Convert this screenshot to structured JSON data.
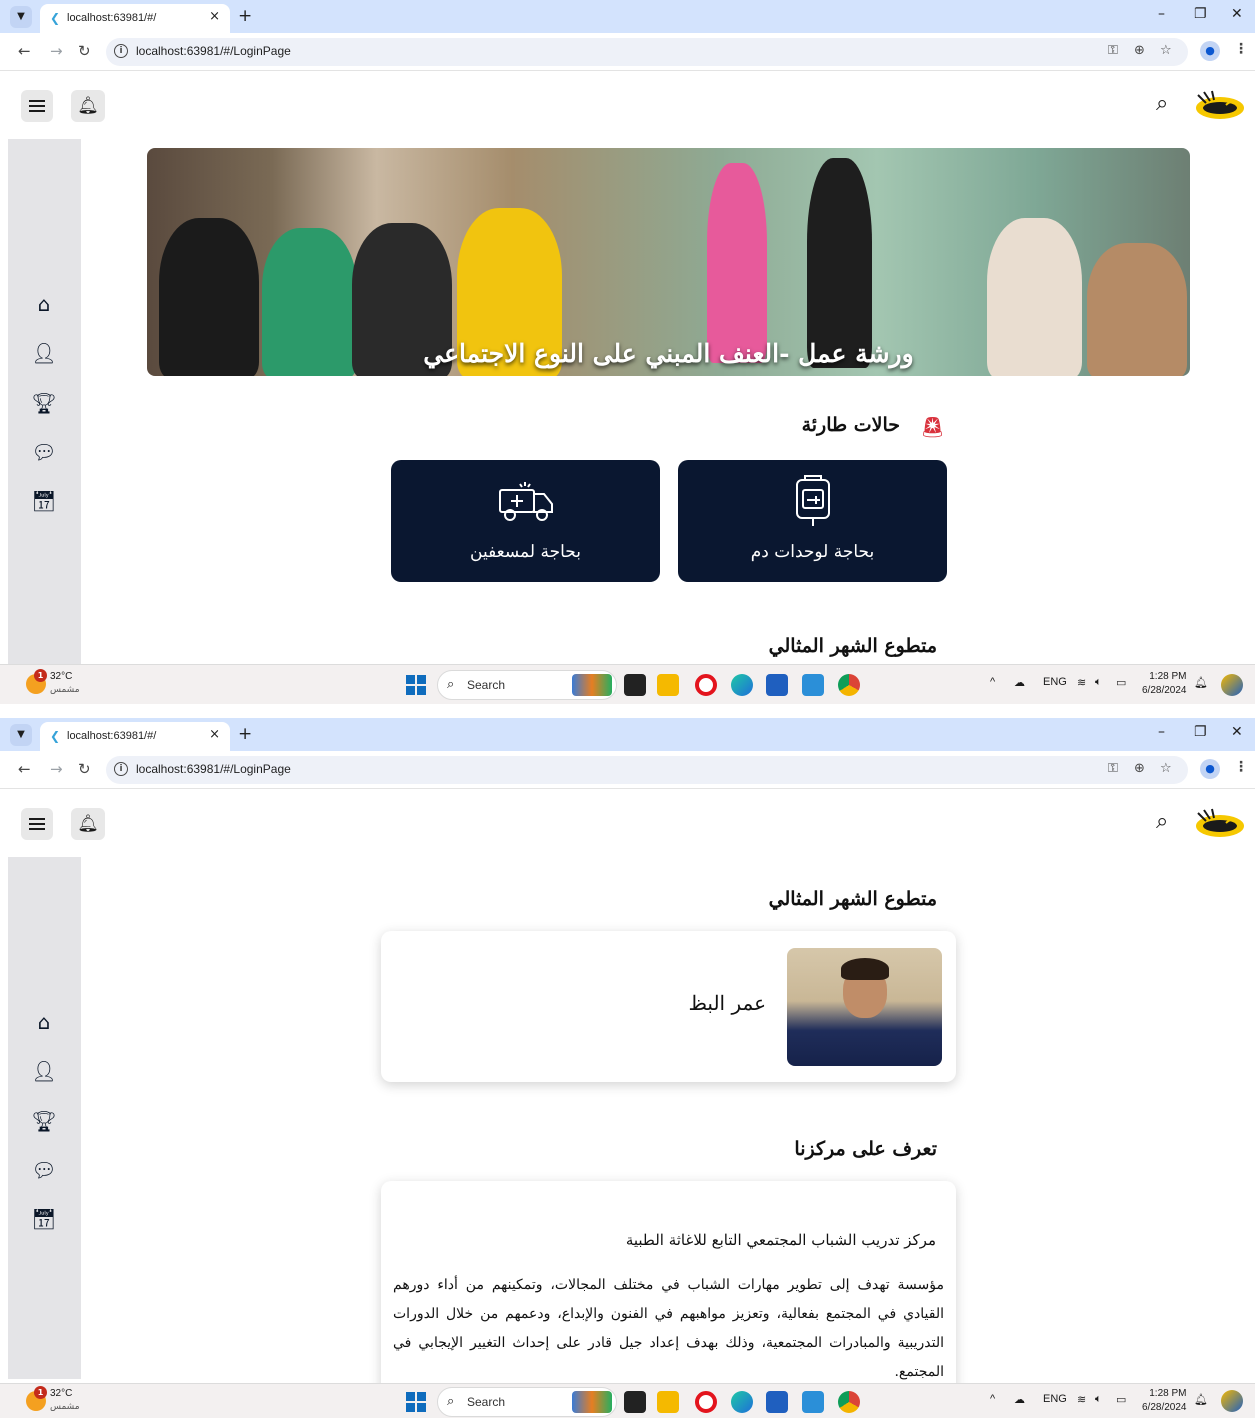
{
  "browser": {
    "tab_title": "localhost:63981/#/",
    "url": "localhost:63981/#/LoginPage",
    "new_tab": "+",
    "tab_close": "×",
    "minimize": "–",
    "restore": "❐",
    "close": "✕"
  },
  "app": {
    "banner_caption": "ورشة عمل -العنف المبني على النوع الاجتماعي",
    "emergency_title": "حالات طارئة",
    "emergency_cards": [
      {
        "label": "بحاجة لمسعفين",
        "icon": "ambulance-icon"
      },
      {
        "label": "بحاجة لوحدات دم",
        "icon": "blood-bag-icon"
      }
    ],
    "volunteer_title": "متطوع الشهر المثالي",
    "volunteer_name": "عمر البظ",
    "about_title": "تعرف على مركزنا",
    "about_heading": "مركز تدريب الشباب المجتمعي التابع للاغاثة الطبية",
    "about_body": "مؤسسة تهدف إلى تطوير مهارات الشباب في مختلف المجالات، وتمكينهم من أداء دورهم القيادي في المجتمع بفعالية، وتعزيز مواهبهم في الفنون والإبداع، ودعمهم من خلال الدورات التدريبية والمبادرات المجتمعية، وذلك بهدف إعداد جيل قادر على إحداث التغيير الإيجابي في المجتمع."
  },
  "sidebar": {
    "items": [
      "home-icon",
      "add-user-icon",
      "trophy-icon",
      "chat-icon",
      "calendar-icon"
    ]
  },
  "taskbar": {
    "weather_temp": "32°C",
    "weather_desc": "مشمس",
    "weather_badge": "1",
    "search_placeholder": "Search",
    "lang": "ENG",
    "time": "1:28 PM",
    "date": "6/28/2024"
  }
}
